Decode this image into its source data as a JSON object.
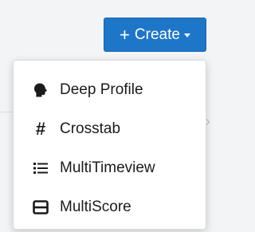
{
  "create_button": {
    "plus": "+",
    "label": "Create"
  },
  "menu": {
    "items": [
      {
        "label": "Deep Profile",
        "icon": "head-profile-icon"
      },
      {
        "label": "Crosstab",
        "icon": "hash-icon",
        "glyph": "#"
      },
      {
        "label": "MultiTimeview",
        "icon": "list-icon"
      },
      {
        "label": "MultiScore",
        "icon": "table-icon"
      }
    ]
  },
  "colors": {
    "accent": "#1e76c9",
    "background": "#f3f4f5",
    "menu_bg": "#ffffff",
    "text": "#1b1b1b"
  }
}
